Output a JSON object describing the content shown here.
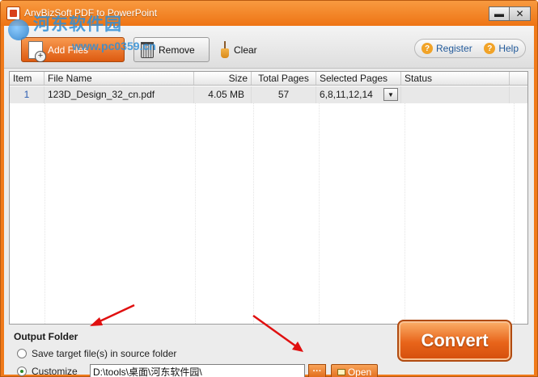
{
  "window": {
    "title": "AnyBizSoft PDF to PowerPoint",
    "minimize": "▬",
    "close": "✕"
  },
  "watermark": {
    "text_cn": "河东软件园",
    "url": "www.pc0359.cn"
  },
  "toolbar": {
    "add_label": "Add Files",
    "remove_label": "Remove",
    "clear_label": "Clear",
    "register_label": "Register",
    "help_label": "Help"
  },
  "table": {
    "columns": [
      "Item",
      "File Name",
      "Size",
      "Total Pages",
      "Selected Pages",
      "Status"
    ],
    "rows": [
      {
        "item": "1",
        "file_name": "123D_Design_32_cn.pdf",
        "size": "4.05  MB",
        "total_pages": "57",
        "selected_pages": "6,8,11,12,14",
        "status": ""
      }
    ]
  },
  "output": {
    "title": "Output Folder",
    "option_source": "Save target file(s) in source folder",
    "option_custom": "Customize",
    "path": "D:\\tools\\桌面\\河东软件园\\",
    "browse_label": "···",
    "open_label": "Open",
    "selected": "custom"
  },
  "convert_label": "Convert",
  "colors": {
    "accent": "#f07a1a",
    "annotation_arrow": "#e01010",
    "link": "#225a9a"
  }
}
